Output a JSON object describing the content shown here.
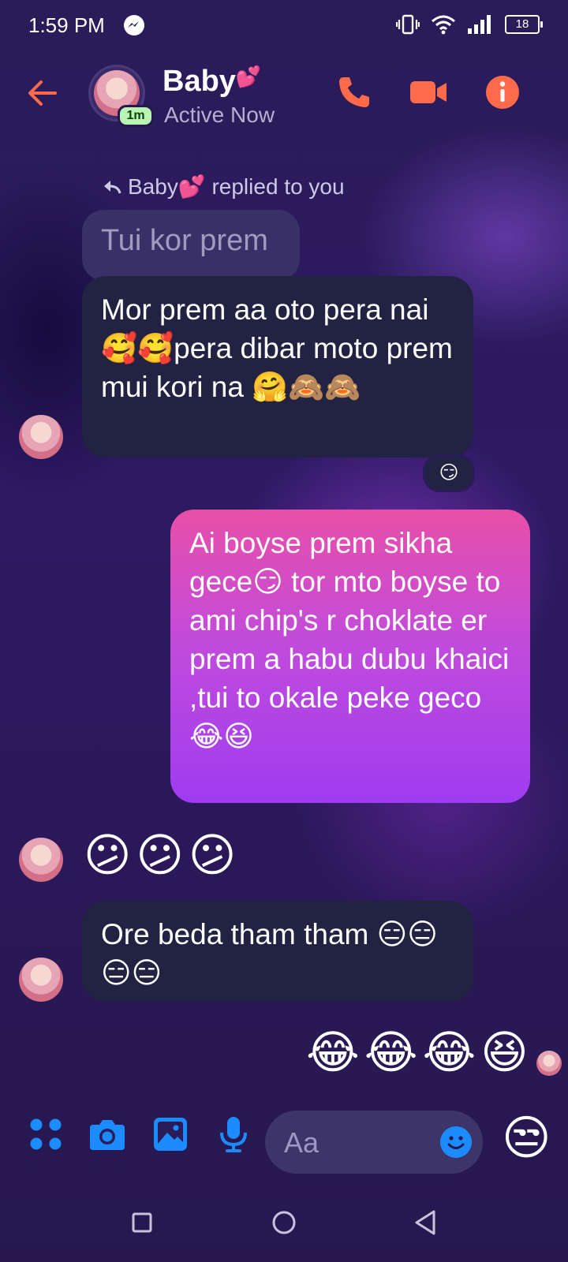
{
  "status_bar": {
    "time": "1:59 PM",
    "battery": "18"
  },
  "header": {
    "contact_name": "Baby",
    "name_emoji": "💕",
    "active_badge": "1m",
    "status": "Active Now"
  },
  "messages": {
    "reply_note": "Baby💕 replied to you",
    "quoted_text": "Tui kor prem",
    "msg1": "Mor prem aa oto pera nai 🥰🥰pera dibar moto prem mui kori na 🤗🙈🙈",
    "msg1_reaction": "😏",
    "msg2": "Ai boyse prem sikha gece😏 tor mto boyse to ami chip's r choklate er prem a habu dubu khaici ,tui to okale peke geco😂😆",
    "msg3": "😕😕😕",
    "msg4": "Ore beda tham tham 😑😑😑😑",
    "msg5": "😂😂😂😆"
  },
  "composer": {
    "placeholder": "Aa",
    "like_emoji": "😒"
  },
  "colors": {
    "accent_orange": "#ff6b4a",
    "blue": "#1b8bff"
  }
}
